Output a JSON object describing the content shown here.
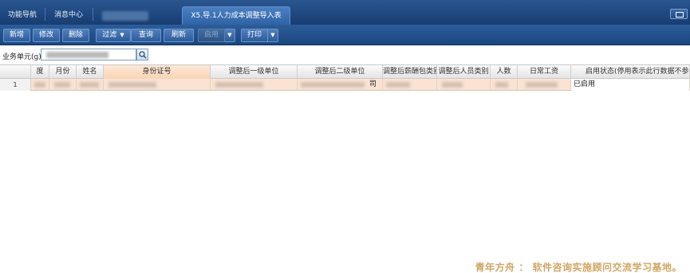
{
  "tabs": [
    {
      "label": "功能导航"
    },
    {
      "label": "消息中心"
    },
    {
      "label": "X5.导.1人力成本调整导入表"
    }
  ],
  "toolbar": {
    "new": "新增",
    "edit": "修改",
    "delete": "删除",
    "filter": "过滤",
    "query": "查询",
    "refresh": "刷新",
    "enable": "启用",
    "print": "打印"
  },
  "filter": {
    "label": "业务单元(g)"
  },
  "grid": {
    "columns": [
      "度",
      "月份",
      "姓名",
      "身份证号",
      "调整后一级单位",
      "调整后二级单位",
      "调整后薪酬包类别",
      "调整后人员类别",
      "人数",
      "日常工资",
      "启用状态(停用表示此行数据不参与按"
    ],
    "rows": [
      {
        "num": "1",
        "unit2_tail": "司",
        "status": "已启用"
      }
    ]
  },
  "watermark": "青年方舟 ： 软件咨询实施顾问交流学习基地。",
  "colors": {
    "accent": "#1b467f",
    "row_selected": "#fbe3d3",
    "highlight_header": "#f9d4b4"
  }
}
